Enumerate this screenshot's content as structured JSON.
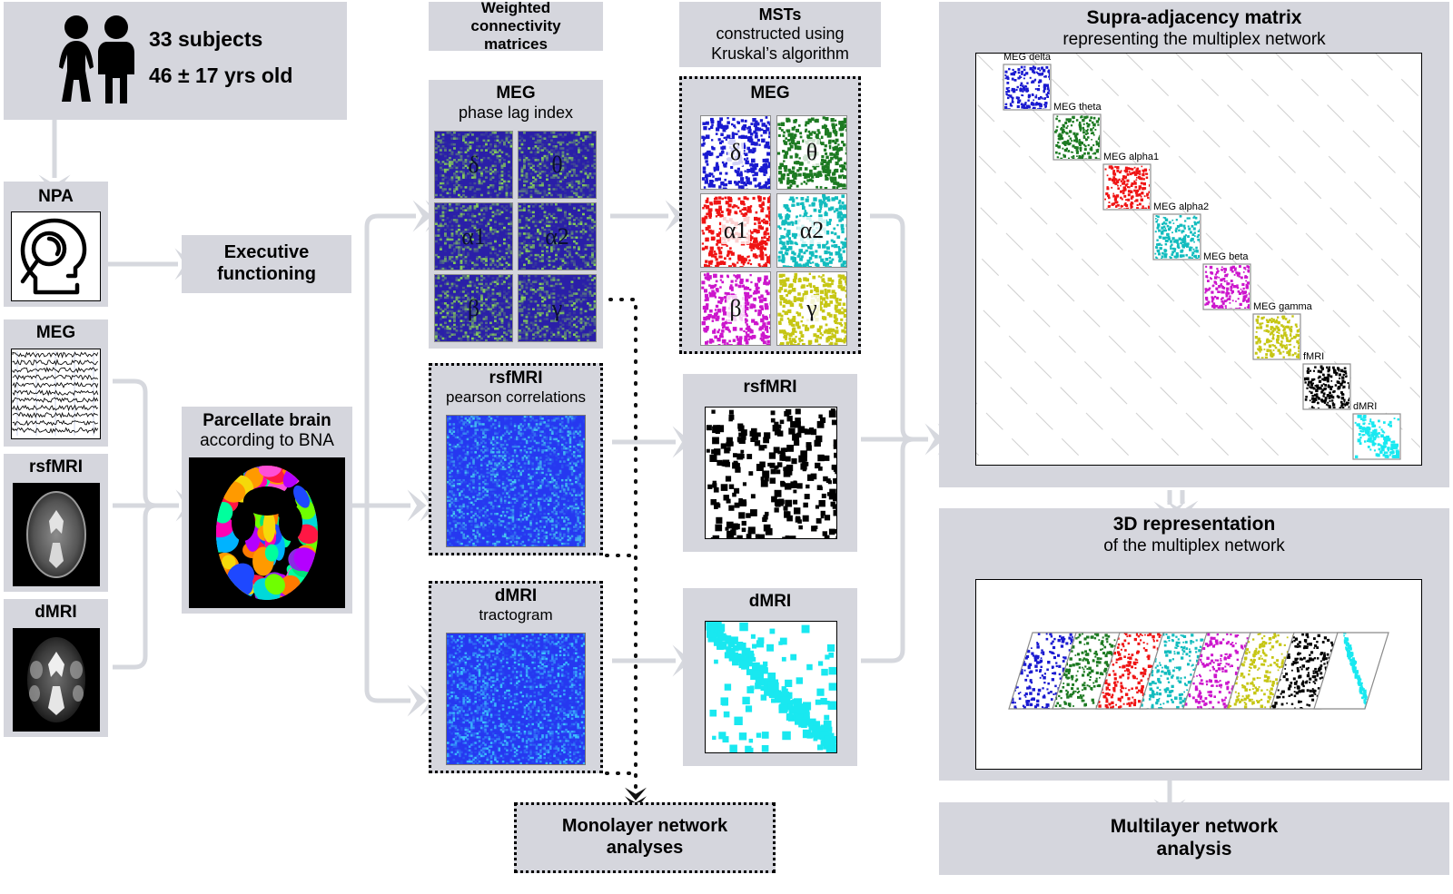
{
  "subjects": {
    "title": "33 subjects",
    "subtitle": "46 ± 17 yrs old",
    "icon": "people-icon"
  },
  "left_column": {
    "npa": {
      "label": "NPA",
      "icon": "head-magnifier-icon"
    },
    "meg": {
      "label": "MEG",
      "icon": "meg-timeseries-icon"
    },
    "rsfmri": {
      "label": "rsfMRI",
      "icon": "brain-mri-axial-icon"
    },
    "dmri": {
      "label": "dMRI",
      "icon": "brain-dmri-axial-icon"
    }
  },
  "executive": {
    "line1": "Executive",
    "line2": "functioning"
  },
  "parcellate": {
    "line1": "Parcellate brain",
    "line2": "according to BNA",
    "icon": "brain-parcellation-icon"
  },
  "weighted": {
    "header": {
      "line1": "Weighted",
      "line2": "connectivity",
      "line3": "matrices"
    },
    "meg": {
      "title": "MEG",
      "subtitle": "phase lag index",
      "bands": [
        "δ",
        "θ",
        "α1",
        "α2",
        "β",
        "γ"
      ]
    },
    "rsfmri": {
      "title": "rsfMRI",
      "subtitle": "pearson correlations"
    },
    "dmri": {
      "title": "dMRI",
      "subtitle": "tractogram"
    }
  },
  "msts": {
    "header": {
      "line1": "MSTs",
      "line2": "constructed using",
      "line3": "Kruskal’s algorithm"
    },
    "meg": {
      "title": "MEG",
      "bands": [
        "δ",
        "θ",
        "α1",
        "α2",
        "β",
        "γ"
      ]
    },
    "rsfmri": {
      "title": "rsfMRI"
    },
    "dmri": {
      "title": "dMRI"
    }
  },
  "monolayer": {
    "line1": "Monolayer network",
    "line2": "analyses"
  },
  "supra": {
    "title": "Supra-adjacency matrix",
    "subtitle": "representing the multiplex network",
    "blocks": [
      {
        "label": "MEG delta",
        "color": "#1a1ad0"
      },
      {
        "label": "MEG theta",
        "color": "#1d7a22"
      },
      {
        "label": "MEG alpha1",
        "color": "#ef1414"
      },
      {
        "label": "MEG alpha2",
        "color": "#13bcbe"
      },
      {
        "label": "MEG beta",
        "color": "#cc16cc"
      },
      {
        "label": "MEG gamma",
        "color": "#c6c615"
      },
      {
        "label": "fMRI",
        "color": "#000000"
      },
      {
        "label": "dMRI",
        "color": "#19e8f0"
      }
    ]
  },
  "threed": {
    "title": "3D representation",
    "subtitle": "of the multiplex network",
    "layers": [
      "#1a1ad0",
      "#1d7a22",
      "#ef1414",
      "#13bcbe",
      "#cc16cc",
      "#c6c615",
      "#000000",
      "#19e8f0"
    ]
  },
  "multilayer": {
    "line1": "Multilayer network",
    "line2": "analysis"
  },
  "colors": {
    "panel": "#d5d6dd",
    "arrow": "#d6d8de",
    "mst_blue": "#1a1ad0",
    "mst_green": "#1d7a22",
    "mst_red": "#ef1414",
    "mst_teal": "#13bcbe",
    "mst_magenta": "#cc16cc",
    "mst_olive": "#c6c615",
    "fmri_black": "#000000",
    "dmri_cyan": "#19e8f0"
  }
}
